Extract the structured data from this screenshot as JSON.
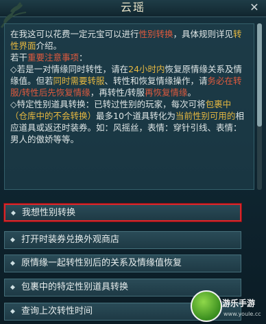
{
  "window": {
    "title": "云瑶",
    "close_glyph": "✕"
  },
  "info": {
    "line1": "在我这可以花费一定元宝可以进行",
    "line1_hl": "性别转换",
    "line1_tail": "，具体规则详见",
    "line1_hl2": "转性界面",
    "line1_tail2": "介绍。",
    "line2a": "若干",
    "line2_hl": "重要注意事项",
    "line2b": "：",
    "b1a": "◇若是一对情缘同时转性，请在",
    "b1_hl": "24小时内",
    "b1b": "恢复原情缘关系及情缘值。但若",
    "b1_hl2": "同时需要转服",
    "b1c": "、转性和恢复情缘操作，请",
    "b1_hl3": "务必在转服/转性后先恢复情缘",
    "b1d": "，再转性/转服",
    "b1_hl4": "再恢复情缘",
    "b1e": "。",
    "b2a": "◇特定性别道具转换：已转过性别的玩家，每次可将",
    "b2_hl": "包裹中（仓库中的不会转换）",
    "b2b": "最多10个道具转化为",
    "b2_hl2": "当前性别可用的",
    "b2c": "相应道具或返还时装券。如：风摇丝，表情：穿针引线、表情：男人的傲娇等等。"
  },
  "options": [
    {
      "label": "我想性别转换"
    },
    {
      "label": "打开时装券兑换外观商店"
    },
    {
      "label": "原情缘一起转性别后的关系及情缘值恢复"
    },
    {
      "label": "包裹中的特定性别道具转换"
    },
    {
      "label": "查询上次转性时间"
    }
  ],
  "option_marker": "◆",
  "watermark": {
    "text": "游乐手游",
    "url": "www.youle.cc"
  },
  "colors": {
    "highlight": "#e7b840",
    "warning": "#e05a3e",
    "selection": "#d8262b"
  }
}
